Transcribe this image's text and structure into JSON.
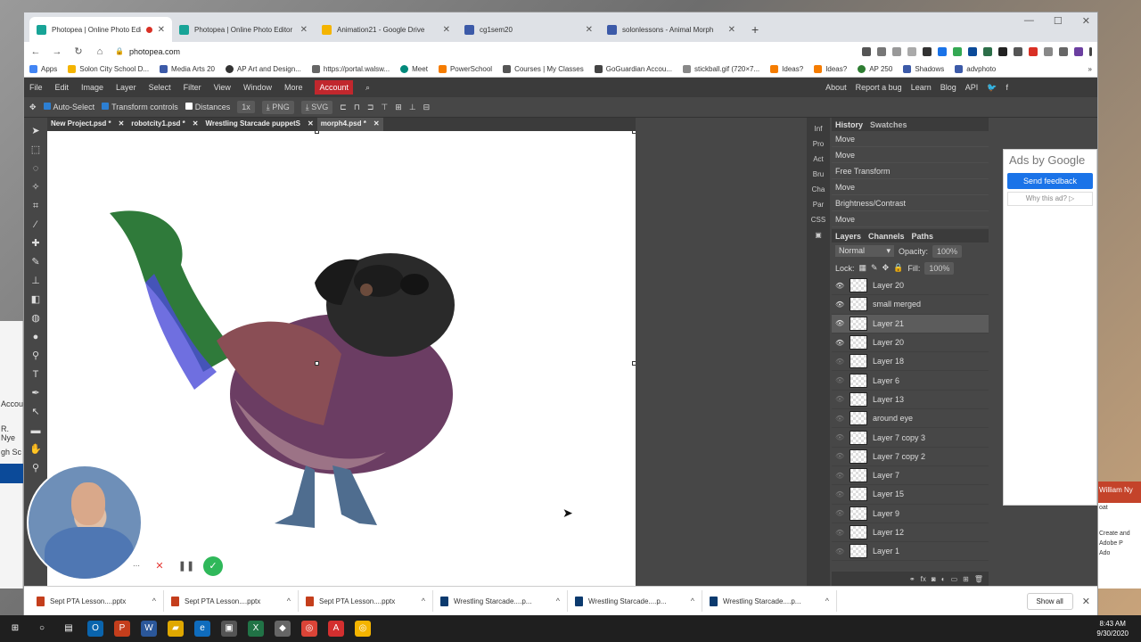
{
  "browser": {
    "tabs": [
      {
        "label": "Photopea | Online Photo Edi",
        "color": "#18a497",
        "active": true
      },
      {
        "label": "Photopea | Online Photo Editor",
        "color": "#18a497"
      },
      {
        "label": "Animation21 - Google Drive",
        "color": "#f4b400"
      },
      {
        "label": "cg1sem20",
        "color": "#3c5aa8"
      },
      {
        "label": "solonlessons - Animal Morph",
        "color": "#3c5aa8"
      }
    ],
    "new_tab": "+",
    "window_controls": [
      "—",
      "☐",
      "✕"
    ],
    "url": "photopea.com",
    "bookmarks": [
      "Apps",
      "Solon City School D...",
      "Media Arts 20",
      "AP Art and Design...",
      "https://portal.walsw...",
      "Meet",
      "PowerSchool",
      "Courses | My Classes",
      "GoGuardian Accou...",
      "stickball.gif (720×7...",
      "Ideas?",
      "Ideas?",
      "AP 250",
      "Shadows",
      "advphoto"
    ],
    "bookmarks_more": "»"
  },
  "photopea": {
    "menu": [
      "File",
      "Edit",
      "Image",
      "Layer",
      "Select",
      "Filter",
      "View",
      "Window",
      "More"
    ],
    "account": "Account",
    "menu_right": [
      "About",
      "Report a bug",
      "Learn",
      "Blog",
      "API"
    ],
    "options": {
      "auto_select": "Auto-Select",
      "transform_controls": "Transform controls",
      "distances": "Distances",
      "zoom": "1x",
      "png": "PNG",
      "svg": "SVG"
    },
    "doc_tabs": [
      {
        "label": "New Project.psd *"
      },
      {
        "label": "robotcity1.psd *"
      },
      {
        "label": "Wrestling Starcade puppetS"
      },
      {
        "label": "morph4.psd *"
      }
    ],
    "side_mini": [
      "Inf",
      "Pro",
      "Act",
      "Bru",
      "Cha",
      "Par",
      "CSS"
    ],
    "history_tabs": [
      "History",
      "Swatches"
    ],
    "history": [
      "Move",
      "Move",
      "Free Transform",
      "Move",
      "Brightness/Contrast",
      "Move"
    ],
    "layers_tabs": [
      "Layers",
      "Channels",
      "Paths"
    ],
    "blend_mode": "Normal",
    "opacity_label": "Opacity:",
    "opacity_value": "100%",
    "lock_label": "Lock:",
    "fill_label": "Fill:",
    "fill_value": "100%",
    "layers": [
      {
        "name": "Layer 20",
        "visible": true
      },
      {
        "name": "small merged",
        "visible": true
      },
      {
        "name": "Layer 21",
        "visible": true,
        "selected": true
      },
      {
        "name": "Layer 20",
        "visible": true
      },
      {
        "name": "Layer 18",
        "visible": false
      },
      {
        "name": "Layer 6",
        "visible": false
      },
      {
        "name": "Layer 13",
        "visible": false
      },
      {
        "name": "around eye",
        "visible": false
      },
      {
        "name": "Layer 7 copy 3",
        "visible": false
      },
      {
        "name": "Layer 7 copy 2",
        "visible": false
      },
      {
        "name": "Layer 7",
        "visible": false
      },
      {
        "name": "Layer 15",
        "visible": false
      },
      {
        "name": "Layer 9",
        "visible": false
      },
      {
        "name": "Layer 12",
        "visible": false
      },
      {
        "name": "Layer 1",
        "visible": false
      }
    ]
  },
  "ad": {
    "ads_by": "Ads by Google",
    "send_feedback": "Send feedback",
    "why": "Why this ad? ▷"
  },
  "downloads": [
    {
      "name": "Sept PTA Lesson....pptx",
      "color": "#c43e1c"
    },
    {
      "name": "Sept PTA Lesson....pptx",
      "color": "#c43e1c"
    },
    {
      "name": "Sept PTA Lesson....pptx",
      "color": "#c43e1c"
    },
    {
      "name": "Wrestling Starcade....p...",
      "color": "#0b3a6e"
    },
    {
      "name": "Wrestling Starcade....p...",
      "color": "#0b3a6e"
    },
    {
      "name": "Wrestling Starcade....p...",
      "color": "#0b3a6e"
    }
  ],
  "show_all": "Show all",
  "clock": {
    "time": "8:43 AM",
    "date": "9/30/2020"
  },
  "left_peek": [
    "Accou",
    "R. Nye",
    "gh Sc"
  ],
  "right_peek": {
    "name": "William Ny",
    "txt1": "oat",
    "txt2": "Create and",
    "txt3": "Adobe P",
    "txt4": "Ado"
  }
}
